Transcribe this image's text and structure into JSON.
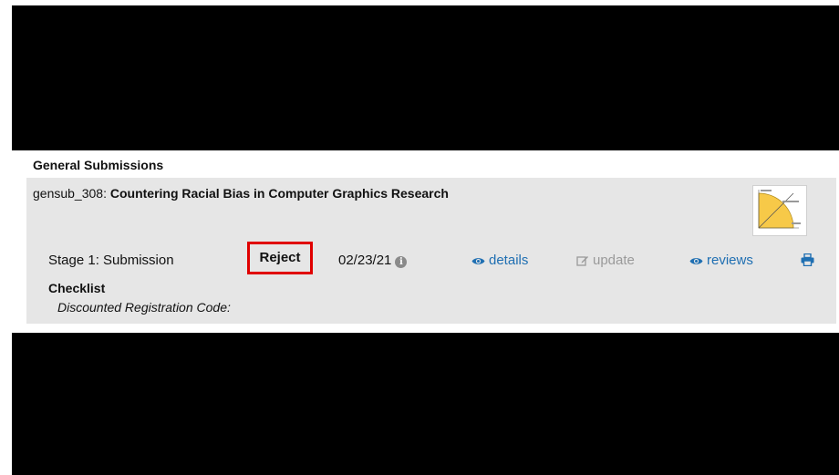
{
  "section": {
    "title": "General Submissions"
  },
  "submission": {
    "id": "gensub_308:",
    "title": "Countering Racial Bias in Computer Graphics Research",
    "stage": "Stage 1: Submission",
    "status": "Reject",
    "date": "02/23/21",
    "actions": {
      "details": "details",
      "update": "update",
      "reviews": "reviews"
    },
    "checklist": {
      "label": "Checklist",
      "items": [
        "Discounted Registration Code:"
      ]
    }
  },
  "colors": {
    "link": "#1f6fb2",
    "disabled": "#9a9a9a",
    "highlight": "#e00000",
    "panel": "#e6e6e6"
  }
}
